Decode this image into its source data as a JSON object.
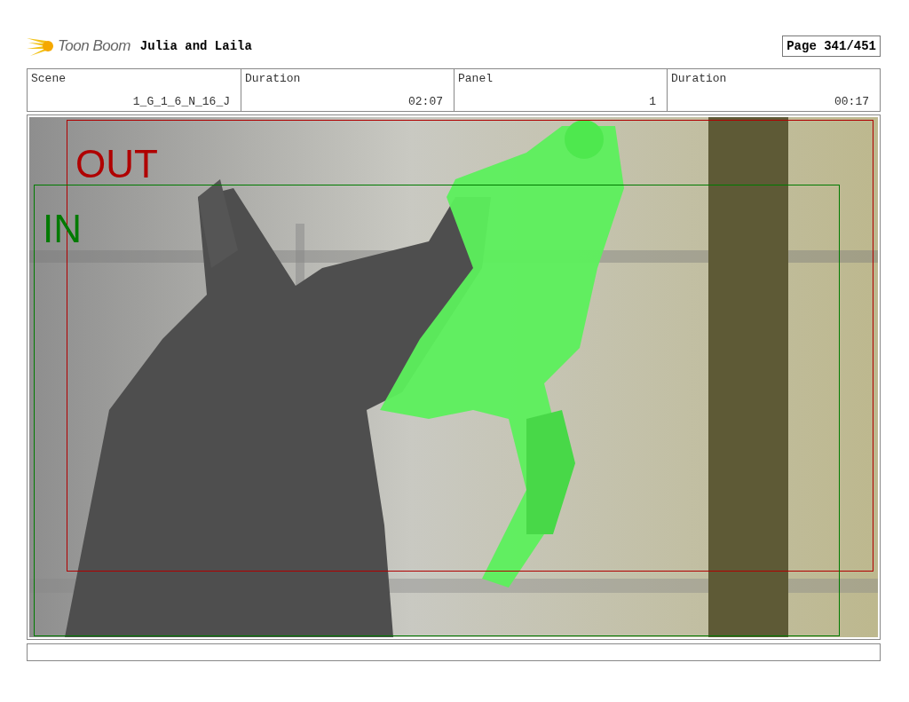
{
  "header": {
    "logo": "Toon Boom",
    "title": "Julia and Laila",
    "page": "Page 341/451"
  },
  "info": [
    {
      "label": "Scene",
      "value": "1_G_1_6_N_16_J"
    },
    {
      "label": "Duration",
      "value": "02:07"
    },
    {
      "label": "Panel",
      "value": "1"
    },
    {
      "label": "Duration",
      "value": "00:17"
    }
  ],
  "panel": {
    "frames": [
      {
        "label": "OUT",
        "color": "#b00000"
      },
      {
        "label": "IN",
        "color": "#007a00"
      }
    ]
  }
}
